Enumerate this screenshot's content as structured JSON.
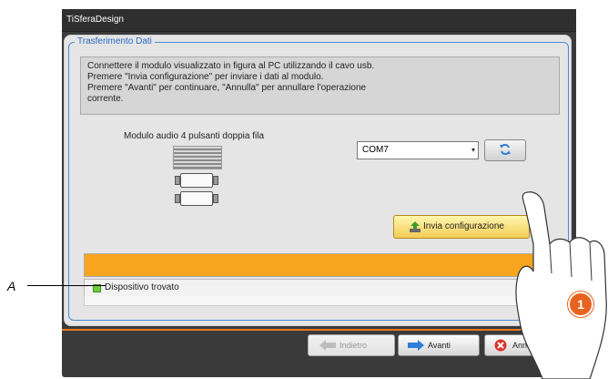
{
  "window": {
    "title": "TiSferaDesign"
  },
  "frame": {
    "legend": "Trasferimento Dati"
  },
  "instructions": {
    "lines": [
      "Connettere il modulo visualizzato in figura al PC utilizzando il cavo usb.",
      "Premere \"Invia configurazione\" per inviare i dati al modulo.",
      "Premere \"Avanti\" per continuare, \"Annulla\" per annullare l'operazione",
      "corrente."
    ]
  },
  "module": {
    "label": "Modulo audio 4 pulsanti doppia fila"
  },
  "port_select": {
    "value": "COM7",
    "icon": "chevron-down-icon"
  },
  "refresh_button": {
    "icon": "refresh-icon"
  },
  "send_button": {
    "label": "Invia configurazione",
    "icon": "upload-arrow-icon"
  },
  "progress": {
    "value": 1.0,
    "color": "#f7a51e"
  },
  "status": {
    "text": "Dispositivo trovato",
    "led_color": "#6fcf3c"
  },
  "nav": {
    "back_label": "Indietro",
    "next_label": "Avanti",
    "cancel_label": "Annulla"
  },
  "annotations": {
    "callout_label": "A",
    "step_number": "1"
  },
  "colors": {
    "accent": "#4a8ad8",
    "divider": "#f1781c",
    "badge": "#e8631f"
  }
}
